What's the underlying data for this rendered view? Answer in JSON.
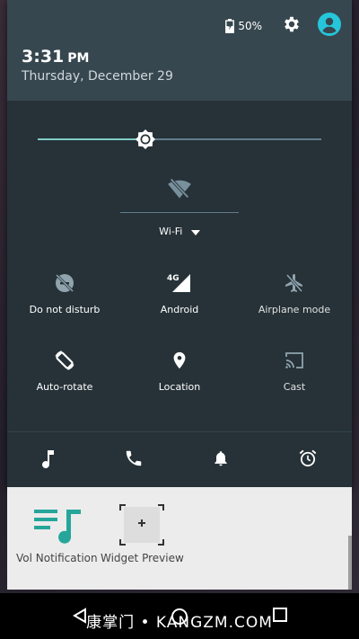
{
  "status": {
    "battery": "50%",
    "time": "3:31",
    "ampm": "PM",
    "date": "Thursday, December 29"
  },
  "brightness": {
    "level": 0.38
  },
  "wifi": {
    "label": "Wi-Fi"
  },
  "tiles": [
    {
      "label": "Do not disturb",
      "icon": "do-not-disturb-icon"
    },
    {
      "label": "Android",
      "icon": "4g-signal-icon",
      "network": "4G"
    },
    {
      "label": "Airplane mode",
      "icon": "airplane-icon"
    },
    {
      "label": "Auto-rotate",
      "icon": "auto-rotate-icon"
    },
    {
      "label": "Location",
      "icon": "location-icon"
    },
    {
      "label": "Cast",
      "icon": "cast-icon"
    }
  ],
  "media": [
    "music-note-icon",
    "phone-icon",
    "bell-icon",
    "alarm-icon"
  ],
  "home": {
    "widgets": [
      {
        "label": "Vol Notification"
      },
      {
        "label": "Widget Preview"
      }
    ]
  },
  "watermark": "康掌门 • KANGZM.COM",
  "colors": {
    "header": "#37474f",
    "panel": "#263238",
    "accent": "#80cbc4",
    "profile": "#26c6da"
  }
}
